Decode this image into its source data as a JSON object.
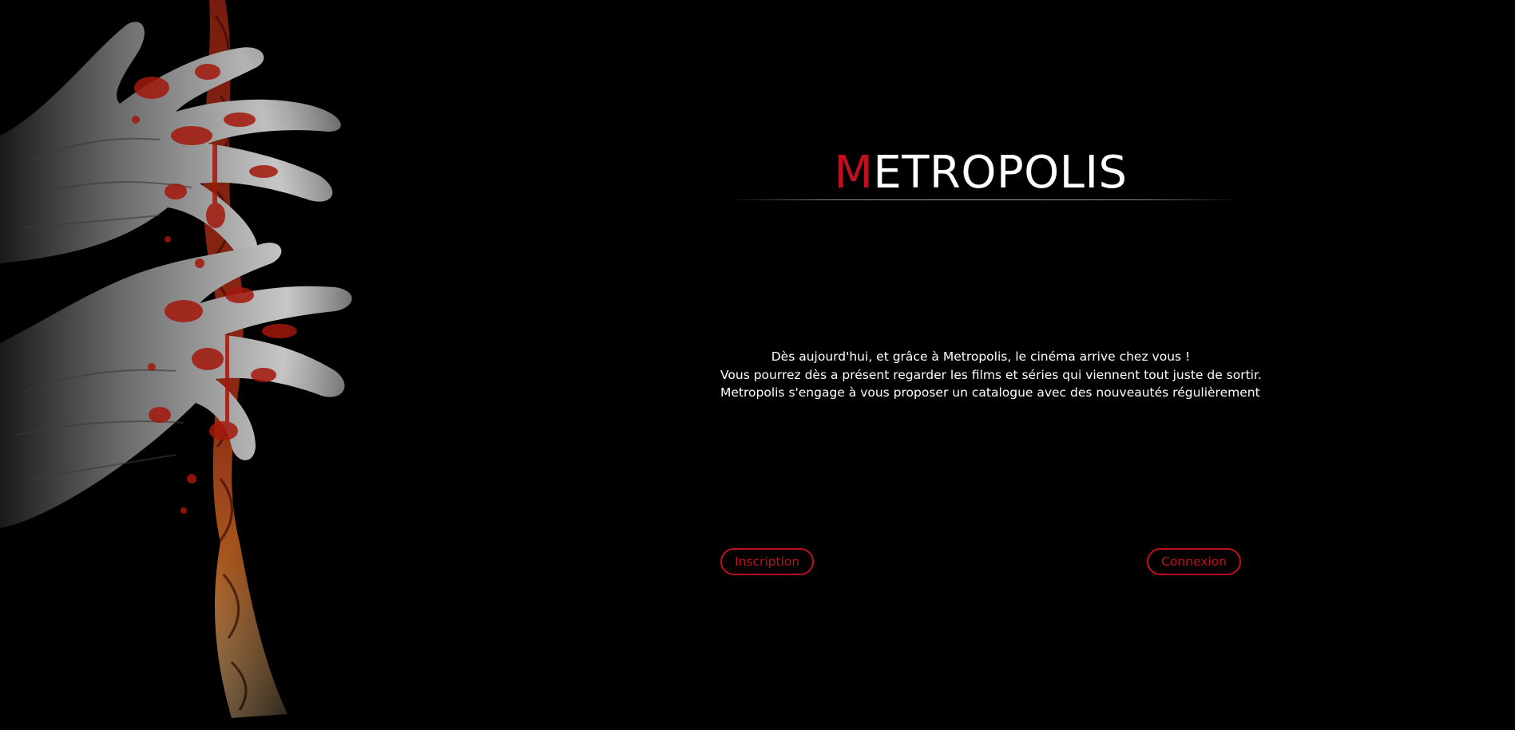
{
  "brand": {
    "initial": "M",
    "rest": "ETROPOLIS"
  },
  "intro": {
    "lines": [
      "Dès aujourd'hui, et grâce à Metropolis, le cinéma arrive chez vous !",
      "Vous pourrez dès a présent regarder les films et séries qui viennent tout juste de sortir.",
      "Metropolis s'engage à vous proposer un catalogue avec des nouveautés régulièrement"
    ]
  },
  "actions": {
    "signup_label": "Inscription",
    "login_label": "Connexion"
  },
  "artwork": {
    "subject": "bloody hands gripping braided rope"
  },
  "colors": {
    "background": "#000000",
    "accent": "#c0101f",
    "text": "#ffffff"
  }
}
